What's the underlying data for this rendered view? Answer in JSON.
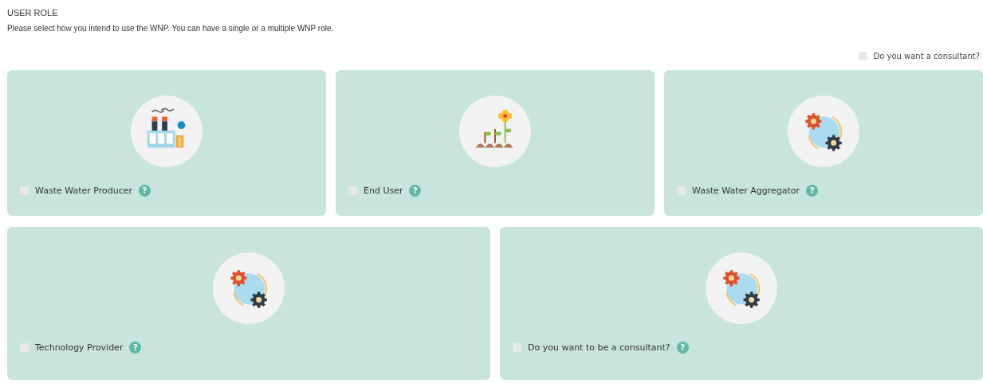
{
  "heading": "USER ROLE",
  "intro": "Please select how you intend to use the WNP. You can have a single or a multiple WNP role.",
  "consultant_option": {
    "label": "Do you want a consultant?",
    "checked": false
  },
  "rows": [
    {
      "cards": [
        {
          "label": "Waste Water Producer",
          "kind": "factory",
          "checked": false,
          "help": "?"
        },
        {
          "label": "End User",
          "kind": "plant",
          "checked": false,
          "help": "?"
        },
        {
          "label": "Waste Water Aggregator",
          "kind": "gears",
          "checked": false,
          "help": "?"
        }
      ]
    },
    {
      "cards": [
        {
          "label": "Technology Provider",
          "kind": "gears",
          "checked": false,
          "help": "?"
        },
        {
          "label": "Do you want to be a consultant?",
          "kind": "gears",
          "checked": false,
          "help": "?"
        }
      ]
    }
  ]
}
